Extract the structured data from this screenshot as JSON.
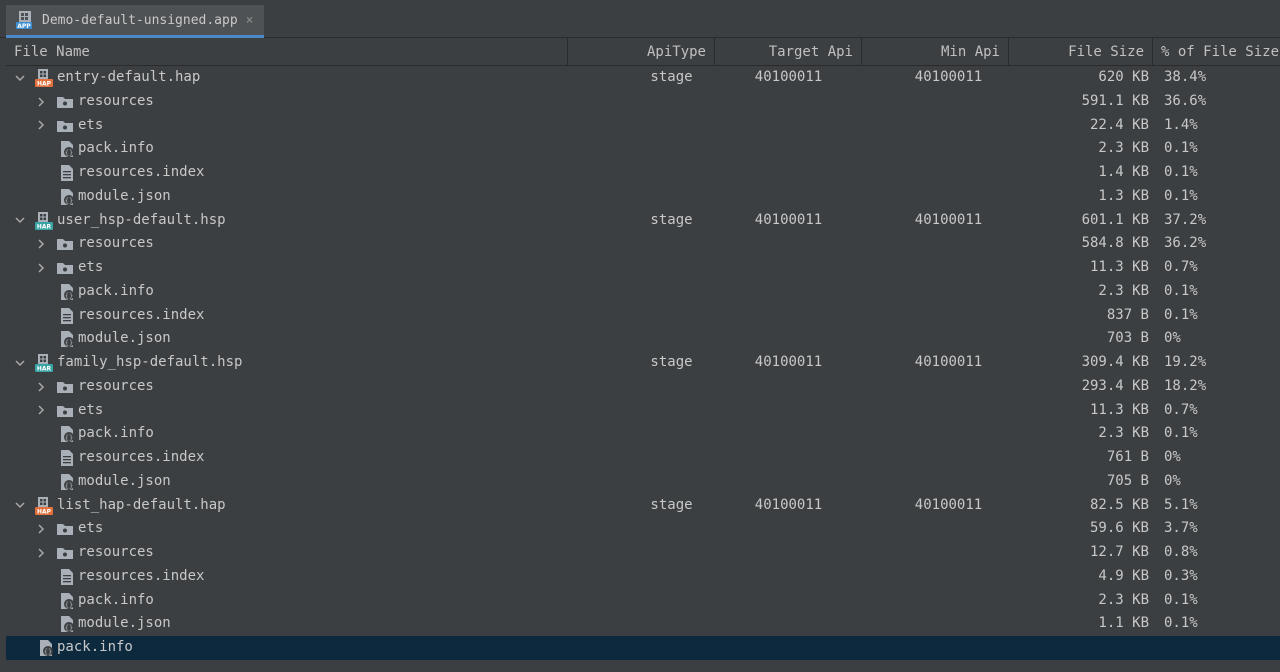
{
  "tab": {
    "title": "Demo-default-unsigned.app",
    "close": "×",
    "icon_text": "APP"
  },
  "columns": {
    "name": "File Name",
    "api_type": "ApiType",
    "target_api": "Target Api",
    "min_api": "Min Api",
    "size": "File Size",
    "percent": "% of File Size"
  },
  "icon_badges": {
    "hap": "HAP",
    "har": "HAR"
  },
  "rows": [
    {
      "name": "entry-default.hap",
      "level": 0,
      "expanded": true,
      "icon": "hap-module-icon",
      "api_type": "stage",
      "target_api": "40100011",
      "min_api": "40100011",
      "size": "620 KB",
      "percent": "38.4%"
    },
    {
      "name": "resources",
      "level": 1,
      "expanded": false,
      "icon": "folder-icon",
      "size": "591.1 KB",
      "percent": "36.6%"
    },
    {
      "name": "ets",
      "level": 1,
      "expanded": false,
      "icon": "folder-icon",
      "size": "22.4 KB",
      "percent": "1.4%"
    },
    {
      "name": "pack.info",
      "level": 1,
      "icon": "json-file-icon",
      "size": "2.3 KB",
      "percent": "0.1%"
    },
    {
      "name": "resources.index",
      "level": 1,
      "icon": "text-file-icon",
      "size": "1.4 KB",
      "percent": "0.1%"
    },
    {
      "name": "module.json",
      "level": 1,
      "icon": "json-file-icon",
      "size": "1.3 KB",
      "percent": "0.1%"
    },
    {
      "name": "user_hsp-default.hsp",
      "level": 0,
      "expanded": true,
      "icon": "har-module-icon",
      "api_type": "stage",
      "target_api": "40100011",
      "min_api": "40100011",
      "size": "601.1 KB",
      "percent": "37.2%"
    },
    {
      "name": "resources",
      "level": 1,
      "expanded": false,
      "icon": "folder-icon",
      "size": "584.8 KB",
      "percent": "36.2%"
    },
    {
      "name": "ets",
      "level": 1,
      "expanded": false,
      "icon": "folder-icon",
      "size": "11.3 KB",
      "percent": "0.7%"
    },
    {
      "name": "pack.info",
      "level": 1,
      "icon": "json-file-icon",
      "size": "2.3 KB",
      "percent": "0.1%"
    },
    {
      "name": "resources.index",
      "level": 1,
      "icon": "text-file-icon",
      "size": "837 B",
      "percent": "0.1%"
    },
    {
      "name": "module.json",
      "level": 1,
      "icon": "json-file-icon",
      "size": "703 B",
      "percent": "0%"
    },
    {
      "name": "family_hsp-default.hsp",
      "level": 0,
      "expanded": true,
      "icon": "har-module-icon",
      "api_type": "stage",
      "target_api": "40100011",
      "min_api": "40100011",
      "size": "309.4 KB",
      "percent": "19.2%"
    },
    {
      "name": "resources",
      "level": 1,
      "expanded": false,
      "icon": "folder-icon",
      "size": "293.4 KB",
      "percent": "18.2%"
    },
    {
      "name": "ets",
      "level": 1,
      "expanded": false,
      "icon": "folder-icon",
      "size": "11.3 KB",
      "percent": "0.7%"
    },
    {
      "name": "pack.info",
      "level": 1,
      "icon": "json-file-icon",
      "size": "2.3 KB",
      "percent": "0.1%"
    },
    {
      "name": "resources.index",
      "level": 1,
      "icon": "text-file-icon",
      "size": "761 B",
      "percent": "0%"
    },
    {
      "name": "module.json",
      "level": 1,
      "icon": "json-file-icon",
      "size": "705 B",
      "percent": "0%"
    },
    {
      "name": "list_hap-default.hap",
      "level": 0,
      "expanded": true,
      "icon": "hap-module-icon",
      "api_type": "stage",
      "target_api": "40100011",
      "min_api": "40100011",
      "size": "82.5 KB",
      "percent": "5.1%"
    },
    {
      "name": "ets",
      "level": 1,
      "expanded": false,
      "icon": "folder-icon",
      "size": "59.6 KB",
      "percent": "3.7%"
    },
    {
      "name": "resources",
      "level": 1,
      "expanded": false,
      "icon": "folder-icon",
      "size": "12.7 KB",
      "percent": "0.8%"
    },
    {
      "name": "resources.index",
      "level": 1,
      "icon": "text-file-icon",
      "size": "4.9 KB",
      "percent": "0.3%"
    },
    {
      "name": "pack.info",
      "level": 1,
      "icon": "json-file-icon",
      "size": "2.3 KB",
      "percent": "0.1%"
    },
    {
      "name": "module.json",
      "level": 1,
      "icon": "json-file-icon",
      "size": "1.1 KB",
      "percent": "0.1%"
    },
    {
      "name": "pack.info",
      "level": 0,
      "icon": "json-file-icon",
      "selected": true
    }
  ],
  "colors": {
    "background": "#3c3f41",
    "selected_row": "#0d293e",
    "tab_underline": "#4a88c7",
    "hap_badge": "#e0703c",
    "har_badge": "#3aa3a3",
    "folder": "#a9b0b7"
  }
}
